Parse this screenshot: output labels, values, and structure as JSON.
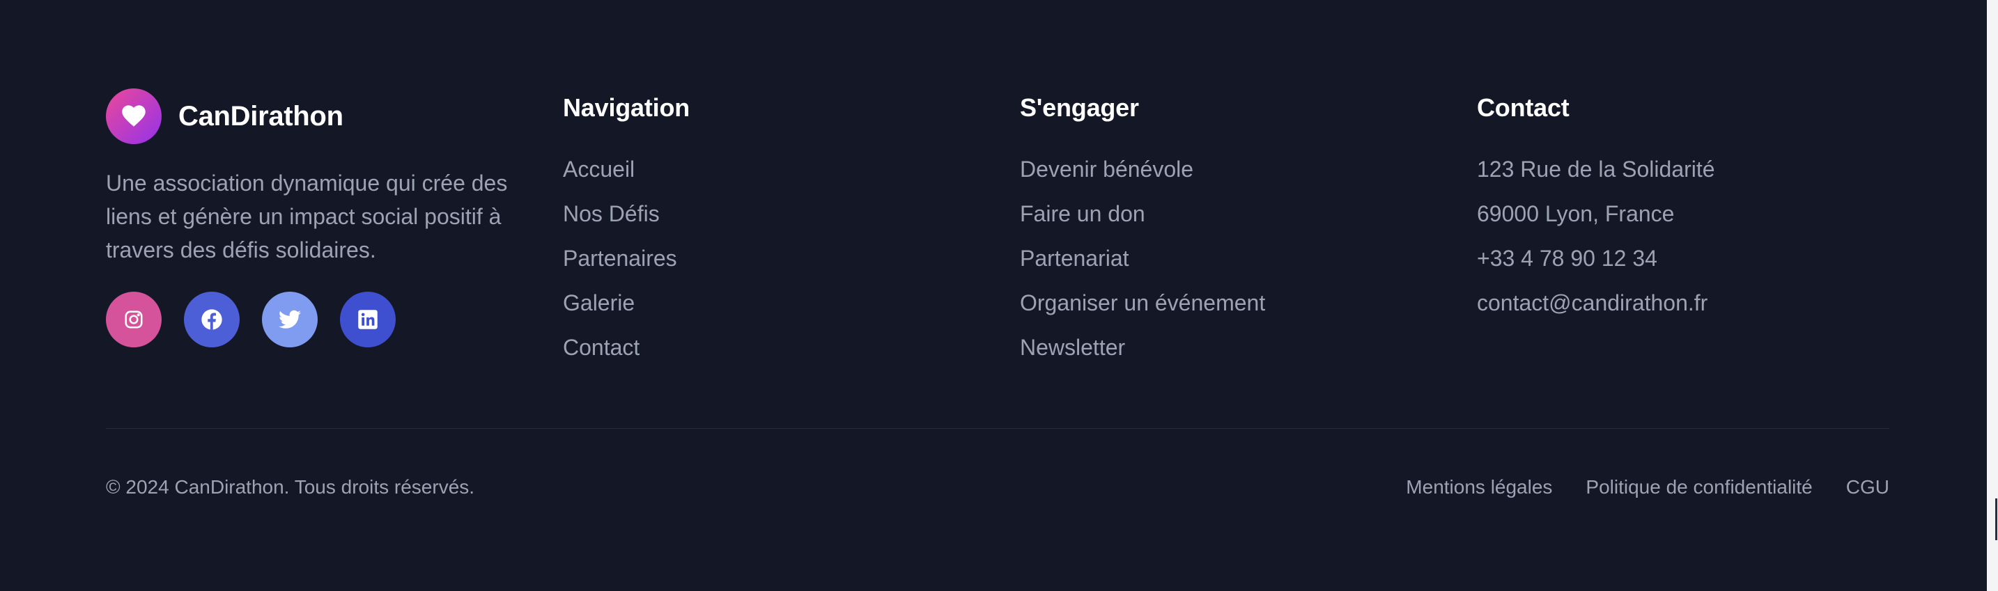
{
  "brand": {
    "name": "CanDirathon",
    "tagline": "Une association dynamique qui crée des liens et génère un impact social positif à travers des défis solidaires.",
    "logo_icon": "heart-icon",
    "gradient": [
      "#ec4899",
      "#9333ea"
    ]
  },
  "socials": [
    {
      "name": "Instagram",
      "icon": "instagram-icon",
      "color": "#d4539a"
    },
    {
      "name": "Facebook",
      "icon": "facebook-icon",
      "color": "#4c5fd6"
    },
    {
      "name": "Twitter",
      "icon": "twitter-icon",
      "color": "#7f9cf0"
    },
    {
      "name": "LinkedIn",
      "icon": "linkedin-icon",
      "color": "#3e4fcf"
    }
  ],
  "navigation": {
    "title": "Navigation",
    "items": [
      "Accueil",
      "Nos Défis",
      "Partenaires",
      "Galerie",
      "Contact"
    ]
  },
  "engage": {
    "title": "S'engager",
    "items": [
      "Devenir bénévole",
      "Faire un don",
      "Partenariat",
      "Organiser un événement",
      "Newsletter"
    ]
  },
  "contact": {
    "title": "Contact",
    "items": [
      "123 Rue de la Solidarité",
      "69000 Lyon, France",
      "+33 4 78 90 12 34",
      "contact@candirathon.fr"
    ]
  },
  "bottom": {
    "copyright": "© 2024 CanDirathon. Tous droits réservés.",
    "legal": [
      "Mentions légales",
      "Politique de confidentialité",
      "CGU"
    ]
  },
  "colors": {
    "background": "#141726",
    "heading": "#ffffff",
    "text": "#9ca3b3",
    "divider": "#272b3b"
  }
}
